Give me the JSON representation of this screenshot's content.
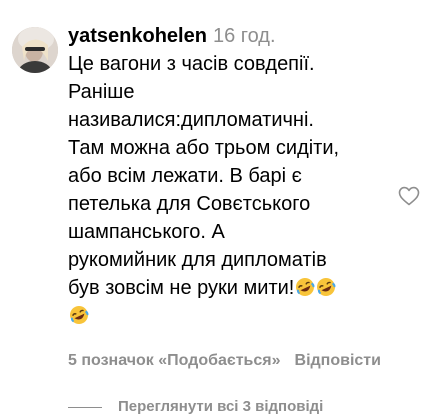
{
  "comment": {
    "username": "yatsenkohelen",
    "time": "16 год.",
    "text_lines": [
      "Це вагони з часів совдепії.",
      "Раніше",
      "називалися:дипломатичні.",
      "Там можна або трьом сидіти,",
      "або всім лежати. В барі є",
      "петелька для Совєтського",
      "шампанського. А",
      "рукомийник для дипломатів",
      "був зовсім не руки мити!"
    ],
    "emoji_name": "rolling-on-floor-laughing",
    "likes": "5 позначок «Подобається»",
    "reply_label": "Відповісти",
    "view_replies": "Переглянути всі 3 відповіді"
  },
  "colors": {
    "text": "#000000",
    "secondary": "#8e8e8e",
    "background": "#ffffff"
  },
  "icons": {
    "like": "heart-outline-icon",
    "avatar": "user-avatar"
  }
}
